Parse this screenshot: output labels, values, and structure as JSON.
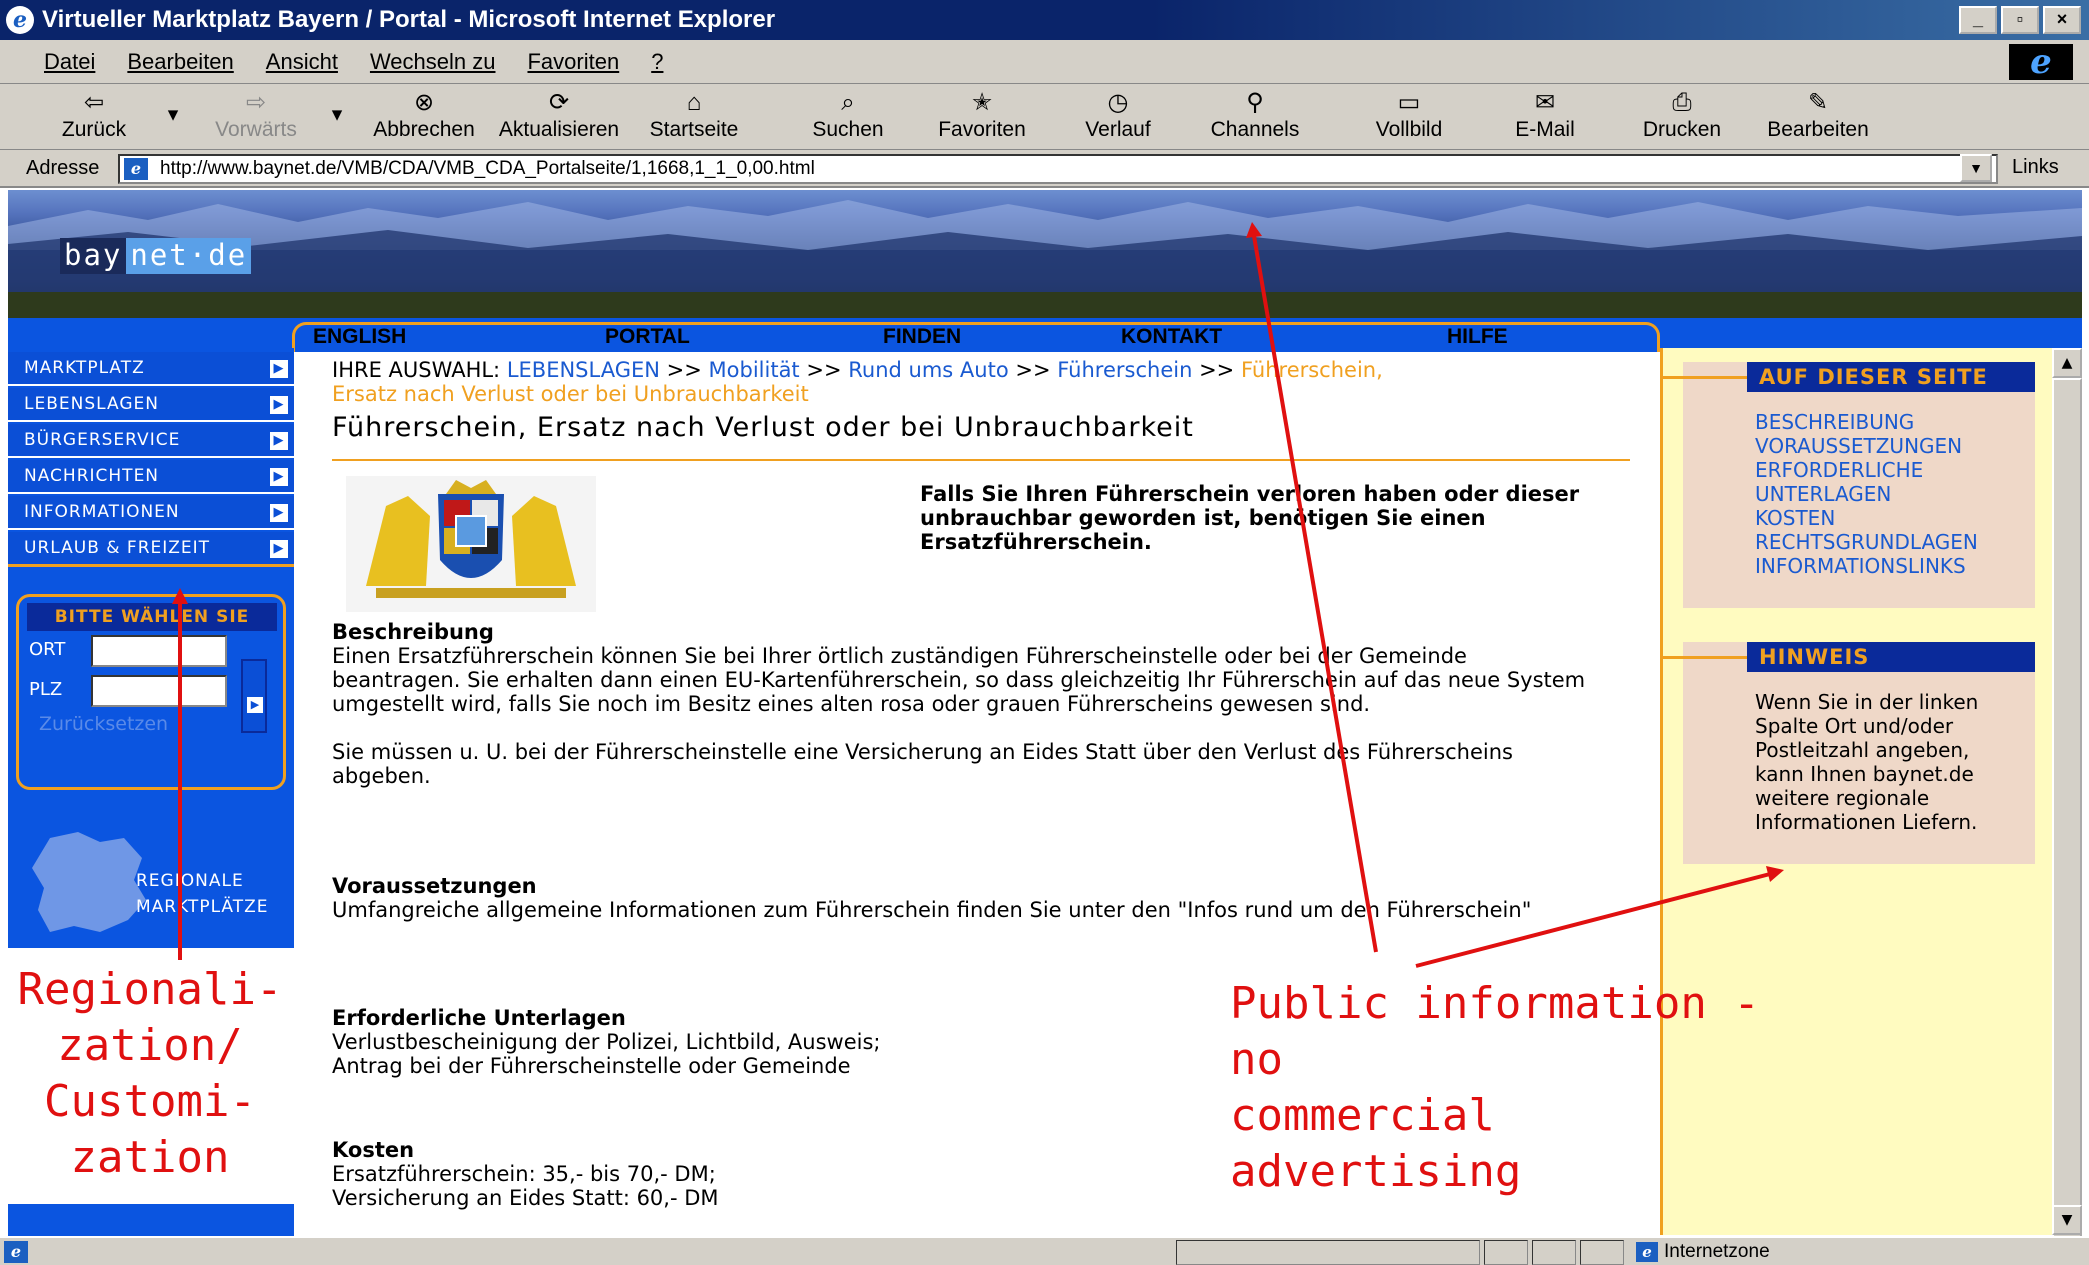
{
  "window": {
    "title": "Virtueller Marktplatz Bayern / Portal - Microsoft Internet Explorer",
    "controls": [
      "_",
      "▫",
      "×"
    ]
  },
  "menubar": [
    "Datei",
    "Bearbeiten",
    "Ansicht",
    "Wechseln zu",
    "Favoriten",
    "?"
  ],
  "toolbar": {
    "back": "Zurück",
    "forward": "Vorwärts",
    "stop": "Abbrechen",
    "refresh": "Aktualisieren",
    "home": "Startseite",
    "search": "Suchen",
    "favorites": "Favoriten",
    "history": "Verlauf",
    "channels": "Channels",
    "fullscreen": "Vollbild",
    "mail": "E-Mail",
    "print": "Drucken",
    "edit": "Bearbeiten"
  },
  "address": {
    "label": "Adresse",
    "url": "http://www.baynet.de/VMB/CDA/VMB_CDA_Portalseite/1,1668,1_1_0,00.html",
    "links": "Links"
  },
  "site": {
    "logo_left": "bay",
    "logo_right": "net·de",
    "nav": [
      "ENGLISH",
      "PORTAL",
      "FINDEN",
      "KONTAKT",
      "HILFE"
    ]
  },
  "sidebar": {
    "items": [
      "MARKTPLATZ",
      "LEBENSLAGEN",
      "BÜRGERSERVICE",
      "NACHRICHTEN",
      "INFORMATIONEN",
      "URLAUB & FREIZEIT"
    ],
    "pick_title": "BITTE WÄHLEN SIE",
    "ort_label": "ORT",
    "plz_label": "PLZ",
    "ort_value": "",
    "plz_value": "",
    "reset": "Zurücksetzen",
    "regional_1": "REGIONALE",
    "regional_2": "MARKTPLÄTZE"
  },
  "content": {
    "crumb_label": "IHRE AUSWAHL:",
    "crumbs": [
      "LEBENSLAGEN",
      "Mobilität",
      "Rund ums Auto",
      "Führerschein"
    ],
    "crumb_sep": ">>",
    "crumb_current_1": "Führerschein,",
    "crumb_current_2": "Ersatz nach Verlust oder bei Unbrauchbarkeit",
    "title": "Führerschein, Ersatz nach Verlust oder bei Unbrauchbarkeit",
    "lead": "Falls Sie Ihren Führerschein verloren haben oder dieser unbrauchbar geworden ist, benötigen Sie einen Ersatzführerschein.",
    "beschreibung_h": "Beschreibung",
    "beschreibung_1": "Einen Ersatzführerschein können Sie bei Ihrer örtlich zuständigen Führerscheinstelle oder bei der Gemeinde beantragen. Sie erhalten dann einen EU-Kartenführerschein, so dass gleichzeitig Ihr Führerschein auf das neue System umgestellt wird, falls Sie noch im Besitz eines alten rosa oder grauen Führerscheins gewesen sind.",
    "beschreibung_2": "Sie müssen u. U. bei der Führerscheinstelle eine Versicherung an Eides Statt über den Verlust des Führerscheins abgeben.",
    "voraussetzungen_h": "Voraussetzungen",
    "voraussetzungen": "Umfangreiche allgemeine Informationen zum Führerschein finden Sie unter den \"Infos rund um den Führerschein\"",
    "unterlagen_h": "Erforderliche Unterlagen",
    "unterlagen_1": "Verlustbescheinigung der Polizei, Lichtbild, Ausweis;",
    "unterlagen_2": "Antrag bei der Führerscheinstelle oder Gemeinde",
    "kosten_h": "Kosten",
    "kosten_1": "Ersatzführerschein: 35,- bis 70,- DM;",
    "kosten_2": "Versicherung an Eides Statt: 60,- DM"
  },
  "right": {
    "auf_title": "AUF DIESER SEITE",
    "auf_links": [
      "BESCHREIBUNG",
      "VORAUSSETZUNGEN",
      "ERFORDERLICHE",
      "UNTERLAGEN",
      "KOSTEN",
      "RECHTSGRUNDLAGEN",
      "INFORMATIONSLINKS"
    ],
    "hinweis_title": "HINWEIS",
    "hinweis_lines": [
      "Wenn Sie in der linken",
      "Spalte Ort und/oder",
      "Postleitzahl angeben,",
      "kann Ihnen baynet.de",
      "weitere regionale",
      "Informationen Liefern."
    ]
  },
  "status": {
    "zone": "Internetzone"
  },
  "annotations": {
    "left": [
      "Regionali-",
      "zation/",
      "Customi-",
      "zation"
    ],
    "right": [
      "Public information - no",
      "commercial advertising"
    ],
    "color": "#e01010"
  }
}
